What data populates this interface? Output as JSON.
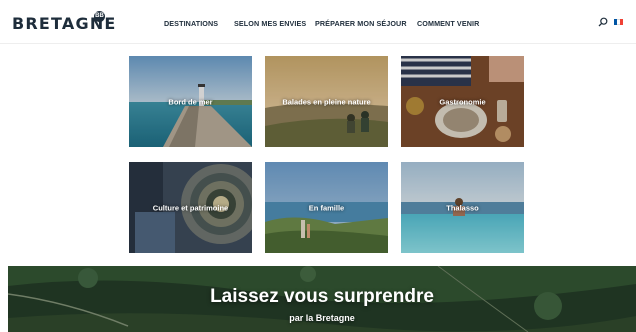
{
  "header": {
    "logo_text": "BRETAGNE",
    "logo_badge": "BB",
    "nav": [
      {
        "label": "DESTINATIONS"
      },
      {
        "label": "SELON MES ENVIES"
      },
      {
        "label": "PRÉPARER MON SÉJOUR"
      },
      {
        "label": "COMMENT VENIR"
      }
    ],
    "search_icon": "search-icon",
    "language_icon": "french-flag-icon"
  },
  "tiles": [
    {
      "label": "Bord de mer"
    },
    {
      "label": "Balades en pleine nature"
    },
    {
      "label": "Gastronomie"
    },
    {
      "label": "Culture et patrimoine"
    },
    {
      "label": "En famille"
    },
    {
      "label": "Thalasso"
    }
  ],
  "banner": {
    "title": "Laissez vous surprendre",
    "subtitle": "par la Bretagne"
  },
  "colors": {
    "text_dark": "#1e2d3b",
    "flag_blue": "#0055a4",
    "flag_red": "#ef4135"
  }
}
